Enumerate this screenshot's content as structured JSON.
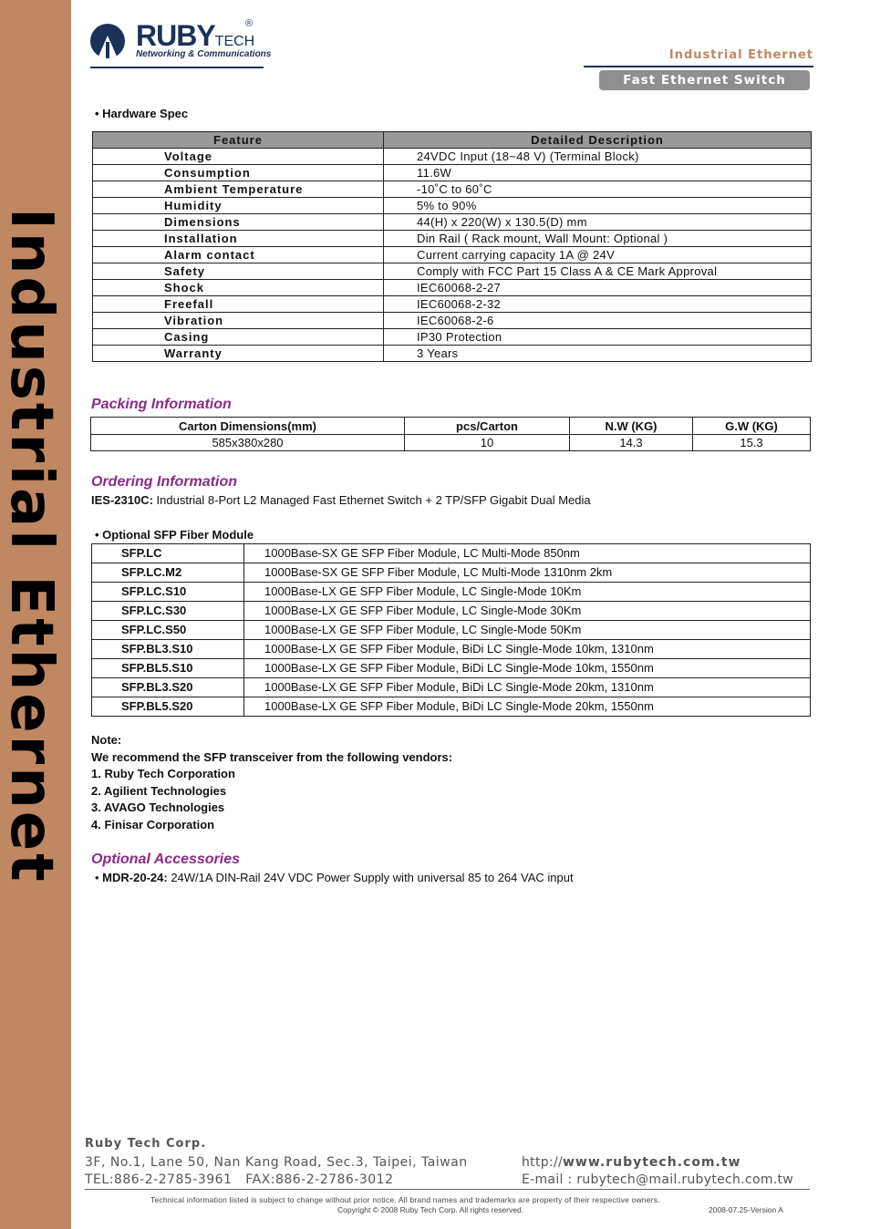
{
  "sidebar": {
    "text": "Industrial Ethernet",
    "color": "#c08763"
  },
  "logo": {
    "word": "RUBY",
    "tech": "TECH",
    "registered": "®",
    "tagline": "Networking & Communications",
    "color": "#1b3159"
  },
  "header": {
    "category": "Industrial Ethernet",
    "product_type": "Fast Ethernet Switch"
  },
  "hardware_spec": {
    "heading": "Hardware Spec",
    "columns": [
      "Feature",
      "Detailed Description"
    ],
    "rows": [
      {
        "feature": "Voltage",
        "desc": "24VDC Input (18~48 V) (Terminal Block)"
      },
      {
        "feature": "Consumption",
        "desc": "11.6W"
      },
      {
        "feature": "Ambient Temperature",
        "desc": "-10˚C to 60˚C"
      },
      {
        "feature": "Humidity",
        "desc": "5% to 90%"
      },
      {
        "feature": "Dimensions",
        "desc": "44(H) x 220(W) x 130.5(D) mm"
      },
      {
        "feature": "Installation",
        "desc": "Din Rail ( Rack mount, Wall Mount: Optional )"
      },
      {
        "feature": "Alarm contact",
        "desc": "Current carrying capacity 1A @ 24V"
      },
      {
        "feature": "Safety",
        "desc": "Comply with FCC Part 15 Class A & CE Mark Approval"
      },
      {
        "feature": "Shock",
        "desc": "IEC60068-2-27"
      },
      {
        "feature": "Freefall",
        "desc": "IEC60068-2-32"
      },
      {
        "feature": "Vibration",
        "desc": "IEC60068-2-6"
      },
      {
        "feature": "Casing",
        "desc": "IP30 Protection"
      },
      {
        "feature": "Warranty",
        "desc": "3 Years"
      }
    ]
  },
  "packing": {
    "title": "Packing Information",
    "columns": [
      "Carton Dimensions(mm)",
      "pcs/Carton",
      "N.W (KG)",
      "G.W (KG)"
    ],
    "row": [
      "585x380x280",
      "10",
      "14.3",
      "15.3"
    ]
  },
  "ordering": {
    "title": "Ordering Information",
    "model": "IES-2310C:",
    "description": "Industrial 8-Port L2 Managed Fast Ethernet Switch + 2 TP/SFP Gigabit Dual Media"
  },
  "sfp": {
    "heading": "Optional SFP Fiber Module",
    "rows": [
      {
        "model": "SFP.LC",
        "desc": "1000Base-SX GE SFP Fiber Module, LC Multi-Mode 850nm"
      },
      {
        "model": "SFP.LC.M2",
        "desc": "1000Base-SX GE SFP Fiber Module, LC Multi-Mode 1310nm 2km"
      },
      {
        "model": "SFP.LC.S10",
        "desc": "1000Base-LX GE SFP Fiber Module, LC Single-Mode 10Km"
      },
      {
        "model": "SFP.LC.S30",
        "desc": "1000Base-LX GE SFP Fiber Module, LC Single-Mode 30Km"
      },
      {
        "model": "SFP.LC.S50",
        "desc": "1000Base-LX GE SFP Fiber Module, LC Single-Mode 50Km"
      },
      {
        "model": "SFP.BL3.S10",
        "desc": "1000Base-LX GE SFP Fiber Module, BiDi LC Single-Mode 10km, 1310nm"
      },
      {
        "model": "SFP.BL5.S10",
        "desc": "1000Base-LX GE SFP Fiber Module, BiDi LC Single-Mode 10km, 1550nm"
      },
      {
        "model": "SFP.BL3.S20",
        "desc": "1000Base-LX GE SFP Fiber Module, BiDi LC Single-Mode 20km, 1310nm"
      },
      {
        "model": "SFP.BL5.S20",
        "desc": "1000Base-LX GE SFP Fiber Module, BiDi LC Single-Mode 20km, 1550nm"
      }
    ]
  },
  "note": {
    "label": "Note:",
    "intro": "We recommend the SFP transceiver from the following vendors:",
    "vendors": [
      "1. Ruby Tech Corporation",
      "2. Agilient Technologies",
      "3. AVAGO Technologies",
      "4. Finisar Corporation"
    ]
  },
  "accessories": {
    "title": "Optional Accessories",
    "model": "MDR-20-24:",
    "description": "24W/1A DIN-Rail 24V VDC Power Supply with universal 85 to 264 VAC input"
  },
  "footer": {
    "company": "Ruby Tech Corp.",
    "address": "3F, No.1, Lane 50, Nan Kang Road, Sec.3, Taipei, Taiwan",
    "tel_fax": "TEL:886-2-2785-3961   FAX:886-2-2786-3012",
    "web_prefix": "http://",
    "web": "www.rubytech.com.tw",
    "email": "E-mail : rubytech@mail.rubytech.com.tw",
    "disclaimer": "Technical information listed is subject to change without prior notice. All brand names and trademarks are property of their respective owners.",
    "copyright": "Copyright © 2008 Ruby Tech Corp. All rights reserved.",
    "version": "2008-07.25-Version A"
  }
}
